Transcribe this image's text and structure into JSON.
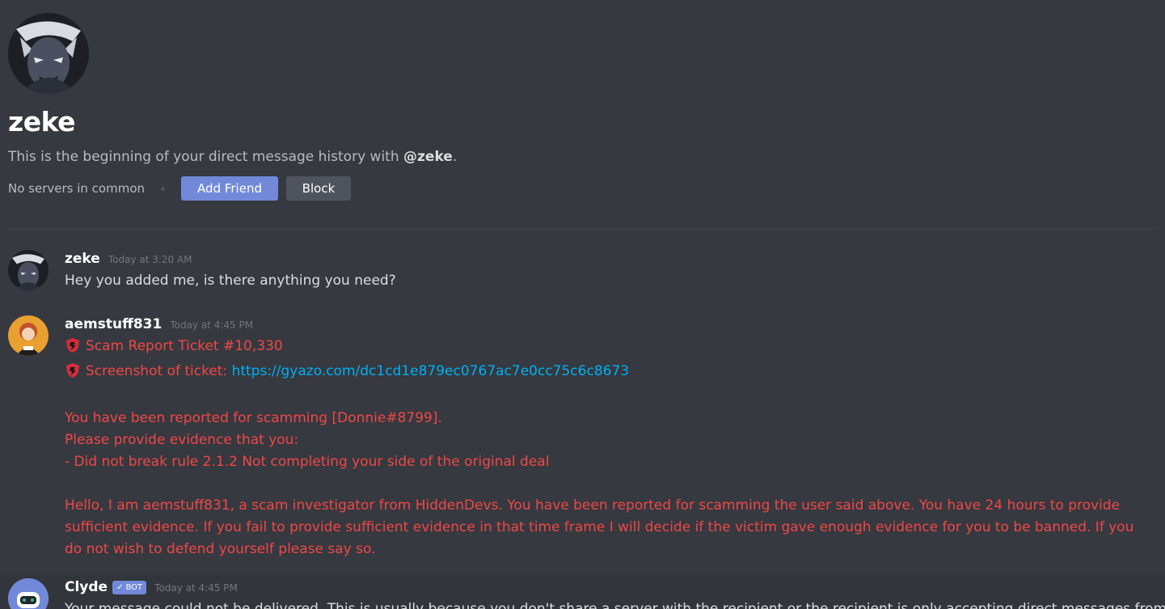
{
  "header": {
    "title": "zeke",
    "description_prefix": "This is the beginning of your direct message history with ",
    "mention": "@zeke",
    "description_suffix": ".",
    "servers_text": "No servers in common",
    "add_friend_label": "Add Friend",
    "block_label": "Block"
  },
  "colors": {
    "background": "#36393f",
    "blurple": "#7289da",
    "red": "#f04747",
    "link": "#00b0f4"
  },
  "messages": [
    {
      "author": "zeke",
      "timestamp": "Today at 3:20 AM",
      "text": "Hey you added me, is there anything you need?"
    },
    {
      "author": "aemstuff831",
      "timestamp": "Today at 4:45 PM",
      "ticket_line": "Scam Report Ticket #10,330",
      "screenshot_label": "Screenshot of ticket:",
      "screenshot_link": "https://gyazo.com/dc1cd1e879ec0767ac7e0cc75c6c8673",
      "report_line_1": "You have been reported for scamming [Donnie#8799].",
      "report_line_2": "Please provide evidence that you:",
      "report_line_3": "- Did not break rule 2.1.2 Not completing your side of the original deal",
      "paragraph": "Hello, I am aemstuff831, a scam investigator from HiddenDevs. You have been reported for scamming the user said above. You have 24 hours to provide sufficient evidence. If you fail to provide sufficient evidence in that time frame I will decide if the victim gave enough evidence for you to be banned. If you do not wish to defend yourself please say so.",
      "icon": "shield-badge-icon"
    },
    {
      "author": "Clyde",
      "bot_tag": "BOT",
      "timestamp": "Today at 4:45 PM",
      "text": "Your message could not be delivered. This is usually because you don't share a server with the recipient or the recipient is only accepting direct messages from"
    }
  ]
}
